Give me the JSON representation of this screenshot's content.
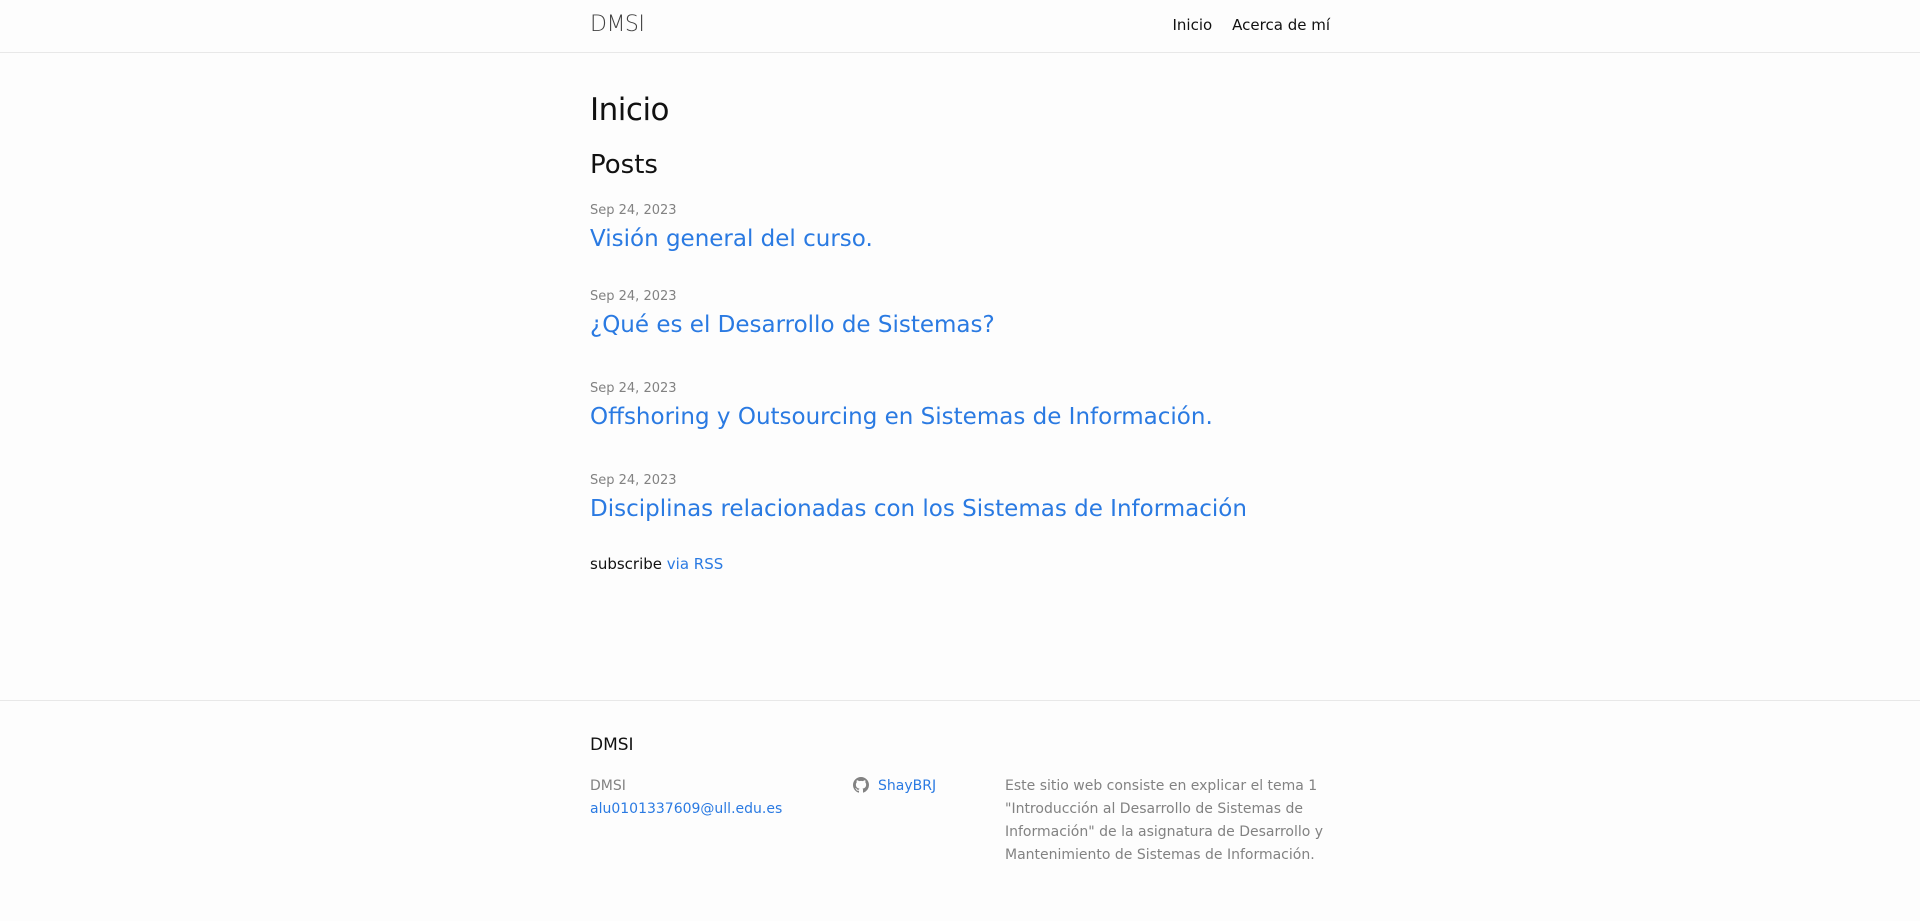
{
  "header": {
    "site_title": "DMSI",
    "nav": [
      {
        "label": "Inicio"
      },
      {
        "label": "Acerca de mí"
      }
    ]
  },
  "main": {
    "page_heading": "Inicio",
    "posts_heading": "Posts",
    "posts": [
      {
        "date": "Sep 24, 2023",
        "title": "Visión general del curso."
      },
      {
        "date": "Sep 24, 2023",
        "title": "¿Qué es el Desarrollo de Sistemas?"
      },
      {
        "date": "Sep 24, 2023",
        "title": "Offshoring y Outsourcing en Sistemas de Información."
      },
      {
        "date": "Sep 24, 2023",
        "title": "Disciplinas relacionadas con los Sistemas de Información"
      }
    ],
    "rss": {
      "prefix": "subscribe",
      "link_label": "via RSS"
    }
  },
  "footer": {
    "heading": "DMSI",
    "name": "DMSI",
    "email": "alu0101337609@ull.edu.es",
    "github_icon": "github-icon",
    "github_user": "ShayBRJ",
    "description": "Este sitio web consiste en explicar el tema 1 \"Introducción al Desarrollo de Sistemas de Información\" de la asignatura de Desarrollo y Mantenimiento de Sistemas de Información."
  },
  "colors": {
    "link": "#2a7ae2",
    "muted": "#828282",
    "text": "#111111",
    "border": "#e8e8e8"
  }
}
